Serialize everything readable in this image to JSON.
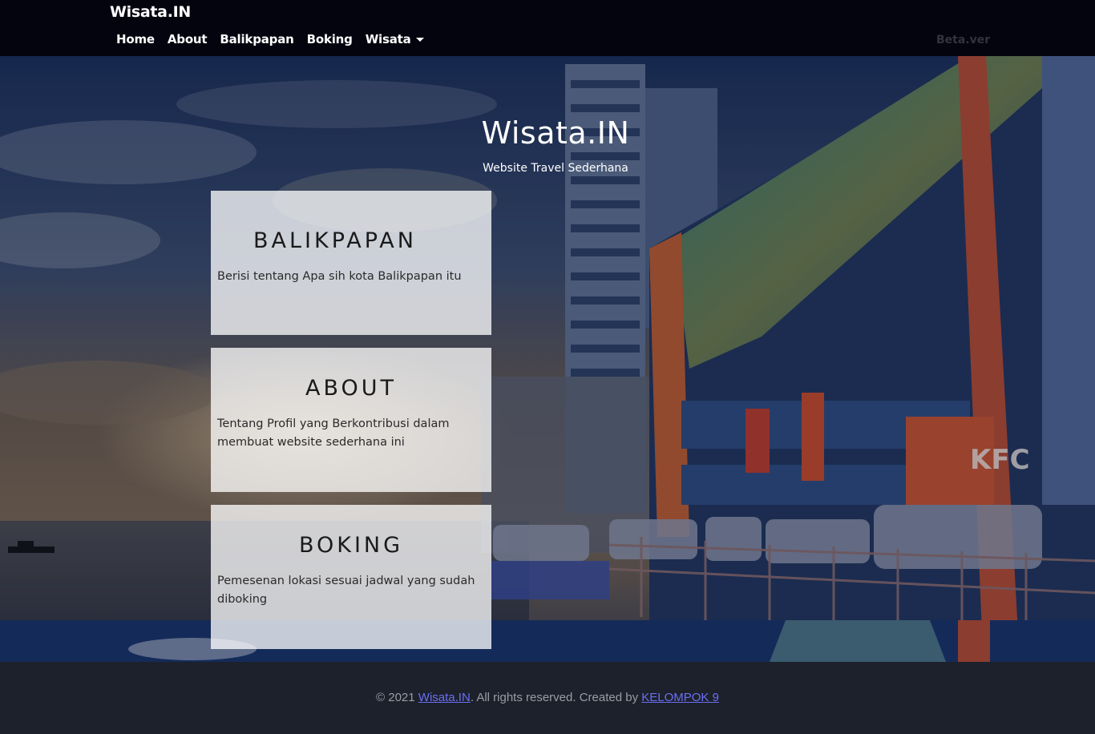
{
  "navbar": {
    "brand": "Wisata.IN",
    "links": [
      "Home",
      "About",
      "Balikpapan",
      "Boking",
      "Wisata"
    ],
    "version_label": "Beta.ver"
  },
  "hero": {
    "title": "Wisata.IN",
    "subtitle": "Website Travel Sederhana"
  },
  "cards": [
    {
      "title": "BALIKPAPAN",
      "description": "Berisi tentang Apa sih kota Balikpapan itu"
    },
    {
      "title": "ABOUT",
      "description": "Tentang Profil yang Berkontribusi dalam membuat website sederhana ini"
    },
    {
      "title": "BOKING",
      "description": "Pemesenan lokasi sesuai jadwal yang sudah diboking"
    }
  ],
  "footer": {
    "prefix": "© 2021 ",
    "site_link": "Wisata.IN",
    "middle": ". All rights reserved. Created by ",
    "team_link": "KELOMPOK 9"
  },
  "colors": {
    "navbar_bg": "#04040f",
    "footer_bg": "#1c212b",
    "link": "#6b6ff2"
  }
}
